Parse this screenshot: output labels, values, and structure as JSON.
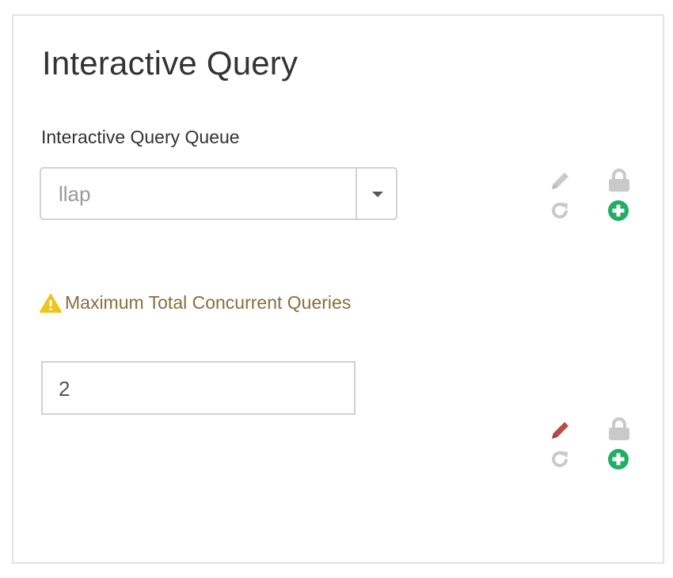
{
  "section": {
    "title": "Interactive Query"
  },
  "queue_field": {
    "label": "Interactive Query Queue",
    "selected_value": "llap"
  },
  "concurrent_field": {
    "label": "Maximum Total Concurrent Queries",
    "value": "2",
    "status": "warning"
  },
  "icons": {
    "edit": "pencil-icon",
    "lock": "lock-icon",
    "undo": "undo-icon",
    "override": "plus-circle-icon",
    "warning": "warning-icon"
  },
  "colors": {
    "warning_text": "#8a6d3b",
    "warning_icon": "#f0c419",
    "edit_active": "#b94a48",
    "icon_muted": "#c9c9c9",
    "override": "#1fae63"
  }
}
